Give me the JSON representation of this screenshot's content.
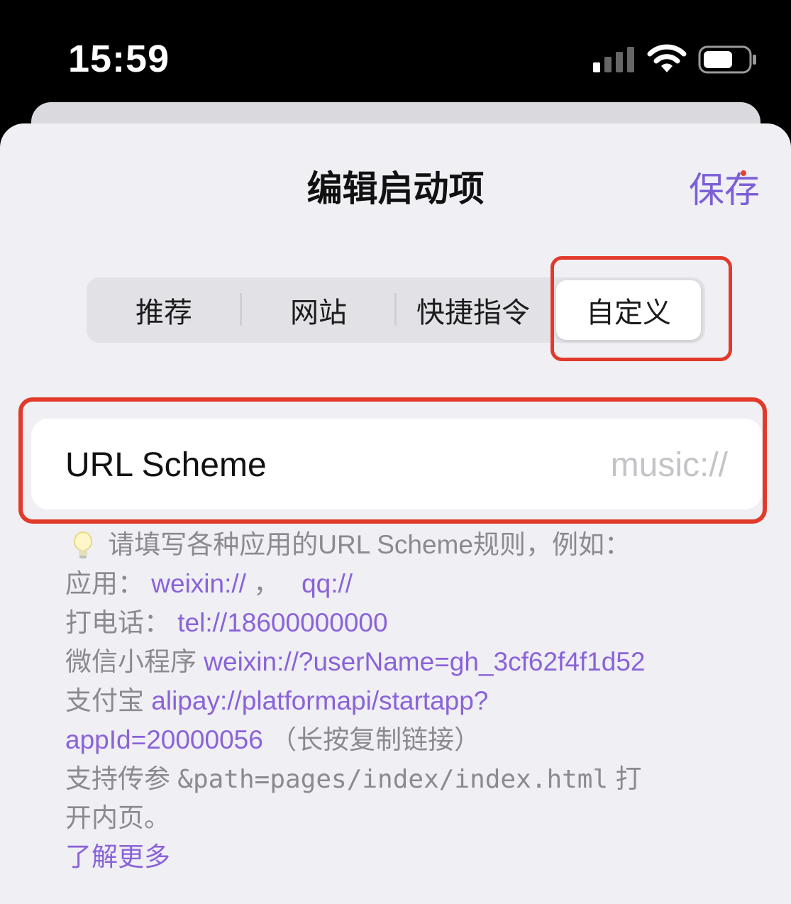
{
  "status_bar": {
    "time": "15:59"
  },
  "header": {
    "title": "编辑启动项",
    "save_label": "保存"
  },
  "tabs": [
    {
      "label": "推荐",
      "active": false
    },
    {
      "label": "网站",
      "active": false
    },
    {
      "label": "快捷指令",
      "active": false
    },
    {
      "label": "自定义",
      "active": true
    }
  ],
  "url_field": {
    "label": "URL Scheme",
    "placeholder": "music://"
  },
  "help": {
    "intro": "请填写各种应用的URL Scheme规则，例如：",
    "apps_prefix": "应用：",
    "app_example_1": "weixin://",
    "apps_sep": " ，",
    "app_example_2": "qq://",
    "phone_prefix": "打电话：",
    "phone_example": "tel://18600000000",
    "miniprogram_prefix": "微信小程序",
    "miniprogram_example": "weixin://?userName=gh_3cf62f4f1d52",
    "alipay_prefix": "支付宝",
    "alipay_example_1": "alipay://platformapi/startapp?",
    "alipay_example_2": "appId=20000056",
    "alipay_suffix": "（长按复制链接）",
    "param_prefix": "支持传参",
    "param_example": "&path=pages/index/index.html",
    "param_suffix_1": "打",
    "param_suffix_2": "开内页。",
    "learn_more": "了解更多"
  },
  "colors": {
    "accent": "#8a63d8",
    "highlight": "#e13a2b",
    "sheet_bg": "#efeff4"
  }
}
